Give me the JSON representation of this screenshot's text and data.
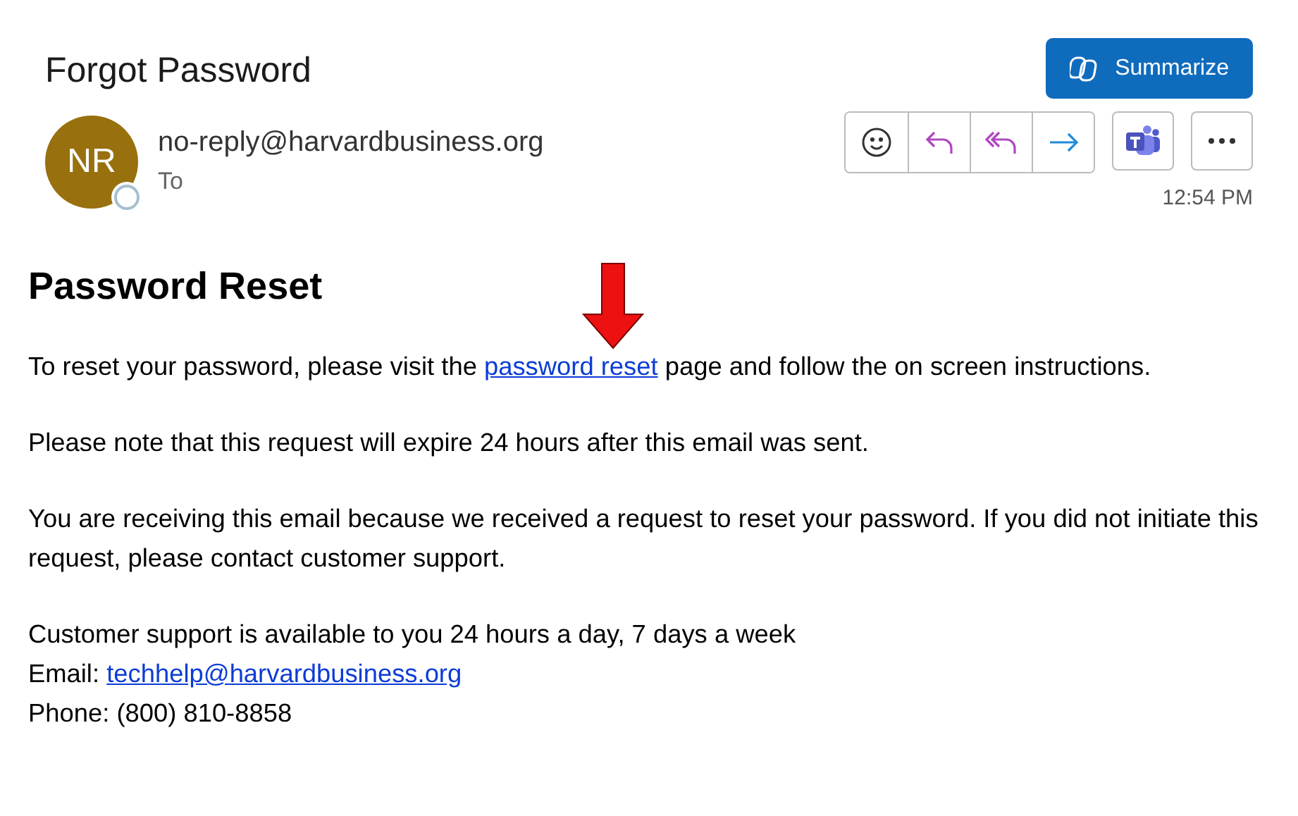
{
  "email": {
    "subject": "Forgot Password",
    "avatar_initials": "NR",
    "sender": "no-reply@harvardbusiness.org",
    "to_label": "To",
    "time": "12:54 PM"
  },
  "summarize_button": {
    "label": "Summarize"
  },
  "body": {
    "heading": "Password Reset",
    "paragraphs": [
      {
        "lines": [
          {
            "parts": [
              {
                "text": "To reset your password, please visit the ",
                "link": false
              },
              {
                "text": "password reset",
                "link": true
              },
              {
                "text": " page and follow the on screen instructions.",
                "link": false
              }
            ]
          }
        ]
      },
      {
        "lines": [
          {
            "parts": [
              {
                "text": "Please note that this request will expire 24 hours after this email was sent.",
                "link": false
              }
            ]
          }
        ]
      },
      {
        "lines": [
          {
            "parts": [
              {
                "text": "You are receiving this email because we received a request to reset your password. If you did not initiate this request, please contact customer support.",
                "link": false
              }
            ]
          }
        ]
      },
      {
        "lines": [
          {
            "parts": [
              {
                "text": "Customer support is available to you 24 hours a day, 7 days a week",
                "link": false
              }
            ]
          },
          {
            "parts": [
              {
                "text": "Email: ",
                "link": false
              },
              {
                "text": "techhelp@harvardbusiness.org",
                "link": true
              }
            ]
          },
          {
            "parts": [
              {
                "text": "Phone: (800) 810-8858",
                "link": false
              }
            ]
          }
        ]
      }
    ]
  }
}
